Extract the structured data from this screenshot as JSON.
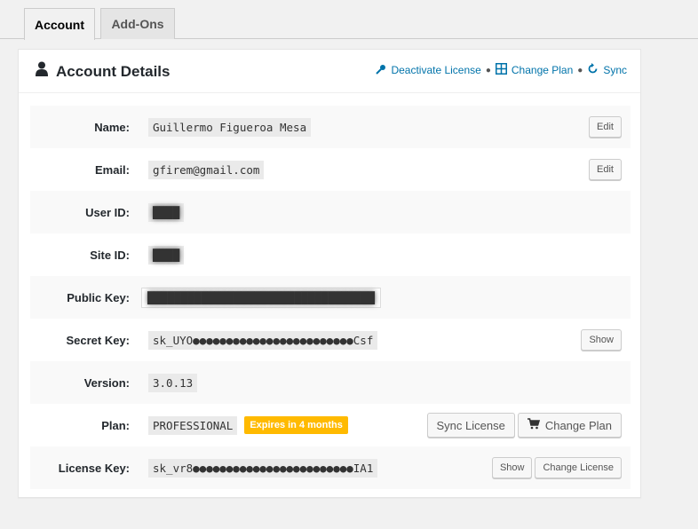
{
  "tabs": [
    {
      "label": "Account",
      "active": true
    },
    {
      "label": "Add-Ons",
      "active": false
    }
  ],
  "card": {
    "title": "Account Details",
    "actions": {
      "deactivate": "Deactivate License",
      "change_plan": "Change Plan",
      "sync": "Sync"
    }
  },
  "rows": {
    "name": {
      "label": "Name:",
      "value": "Guillermo Figueroa Mesa",
      "edit": "Edit"
    },
    "email": {
      "label": "Email:",
      "value": "gfirem@gmail.com",
      "edit": "Edit"
    },
    "user_id": {
      "label": "User ID:"
    },
    "site_id": {
      "label": "Site ID:"
    },
    "public_key": {
      "label": "Public Key:"
    },
    "secret_key": {
      "label": "Secret Key:",
      "value": "sk_UYO●●●●●●●●●●●●●●●●●●●●●●●●Csf",
      "show": "Show"
    },
    "version": {
      "label": "Version:",
      "value": "3.0.13"
    },
    "plan": {
      "label": "Plan:",
      "value": "PROFESSIONAL",
      "badge": "Expires in 4 months",
      "sync_license": "Sync License",
      "change_plan": "Change Plan"
    },
    "license_key": {
      "label": "License Key:",
      "value": "sk_vr8●●●●●●●●●●●●●●●●●●●●●●●●IA1",
      "show": "Show",
      "change_license": "Change License"
    }
  },
  "colors": {
    "link": "#0073aa",
    "badge": "#ffba00",
    "alt_row": "#f9f9f9"
  }
}
